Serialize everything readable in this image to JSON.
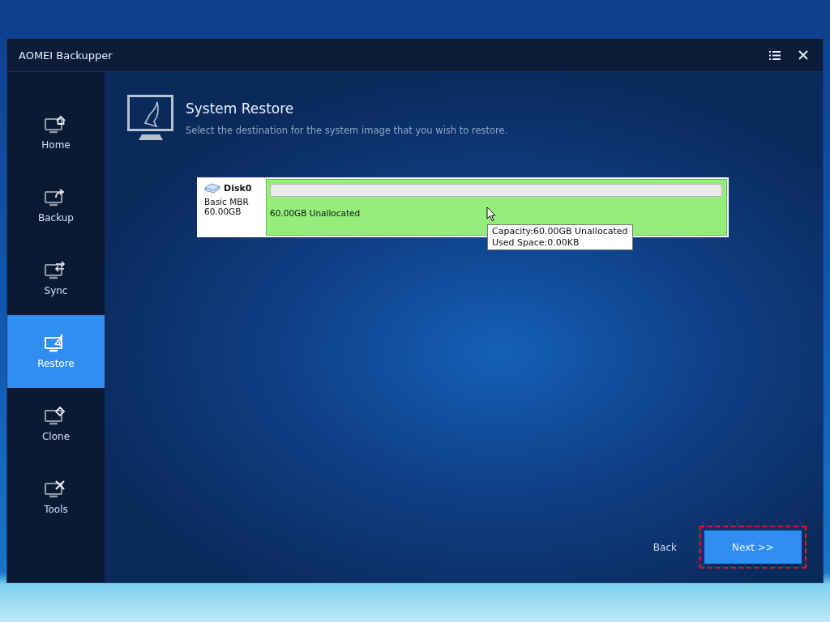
{
  "window": {
    "title": "AOMEI Backupper"
  },
  "sidebar": {
    "items": [
      {
        "kind": "home",
        "label": "Home",
        "selected": false
      },
      {
        "kind": "backup",
        "label": "Backup",
        "selected": false
      },
      {
        "kind": "sync",
        "label": "Sync",
        "selected": false
      },
      {
        "kind": "restore",
        "label": "Restore",
        "selected": true
      },
      {
        "kind": "clone",
        "label": "Clone",
        "selected": false
      },
      {
        "kind": "tools",
        "label": "Tools",
        "selected": false
      }
    ]
  },
  "header": {
    "title": "System Restore",
    "subtitle": "Select the destination for the system image that you wish to restore."
  },
  "disk": {
    "name": "Disk0",
    "type": "Basic MBR",
    "size": "60.00GB",
    "partition": {
      "label": "60.00GB Unallocated"
    }
  },
  "tooltip": {
    "lines": [
      "Capacity:60.00GB Unallocated",
      "Used Space:0.00KB"
    ]
  },
  "footer": {
    "back": "Back",
    "next": {
      "label": "Next >>",
      "outlined": true
    }
  }
}
